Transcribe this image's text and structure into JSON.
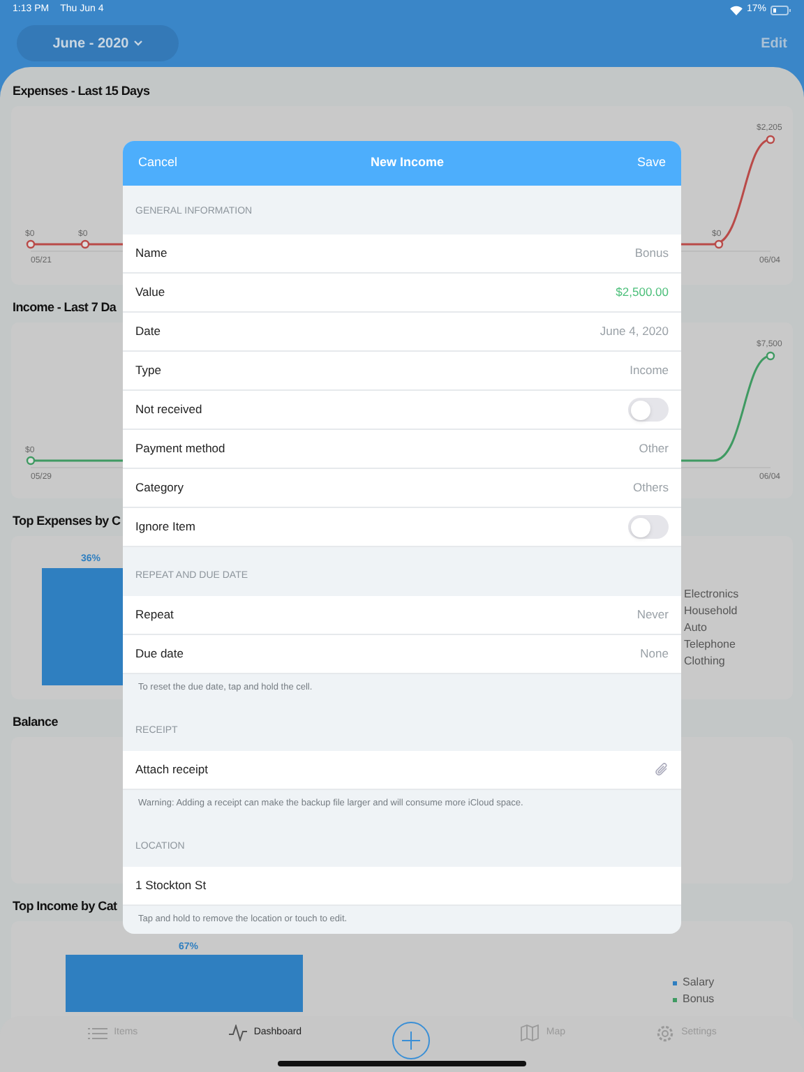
{
  "status_bar": {
    "time": "1:13 PM",
    "date": "Thu Jun 4",
    "battery": "17%"
  },
  "header": {
    "period": "June - 2020",
    "edit": "Edit"
  },
  "dashboard": [
    {
      "title": "Expenses - Last 15 Days",
      "kind": "line",
      "color": "#b94a48",
      "start_labels": [
        "$0",
        "$0"
      ],
      "end_labels": [
        "$0",
        "$2,205"
      ],
      "x_start": "05/21",
      "x_end": "06/04"
    },
    {
      "title": "Income - Last 7 Da",
      "kind": "line",
      "color": "#3f9a62",
      "start_labels": [
        "$0"
      ],
      "end_labels": [
        "$7,500"
      ],
      "x_start": "05/29",
      "x_end": "06/04"
    },
    {
      "title": "Top Expenses by C",
      "kind": "bar",
      "bar_label": "36%",
      "legend": [
        {
          "label": "Electronics"
        },
        {
          "label": "Household"
        },
        {
          "label": "Auto"
        },
        {
          "label": "Telephone"
        },
        {
          "label": "Clothing"
        }
      ]
    },
    {
      "title": "Balance",
      "kind": "empty"
    },
    {
      "title": "Top Income by Cat",
      "kind": "bar",
      "bar_label": "67%",
      "legend": [
        {
          "label": "Salary",
          "color": "#2f7fc0"
        },
        {
          "label": "Bonus",
          "color": "#3f9a62"
        }
      ]
    }
  ],
  "tab_bar": [
    {
      "label": "Items",
      "selected": false
    },
    {
      "label": "Dashboard",
      "selected": true
    },
    {
      "kind": "add"
    },
    {
      "label": "Map",
      "selected": false
    },
    {
      "label": "Settings",
      "selected": false
    }
  ],
  "modal": {
    "cancel": "Cancel",
    "title": "New Income",
    "save": "Save",
    "sections": [
      {
        "header": "GENERAL INFORMATION",
        "rows": [
          {
            "kind": "value",
            "label": "Name",
            "value": "Bonus"
          },
          {
            "kind": "money",
            "label": "Value",
            "value": "$2,500.00"
          },
          {
            "kind": "value",
            "label": "Date",
            "value": "June 4, 2020"
          },
          {
            "kind": "value",
            "label": "Type",
            "value": "Income"
          },
          {
            "kind": "toggle",
            "label": "Not received",
            "on": false
          },
          {
            "kind": "value",
            "label": "Payment method",
            "value": "Other"
          },
          {
            "kind": "value",
            "label": "Category",
            "value": "Others"
          },
          {
            "kind": "toggle",
            "label": "Ignore Item",
            "on": false
          }
        ]
      },
      {
        "header": "REPEAT AND DUE DATE",
        "rows": [
          {
            "kind": "value",
            "label": "Repeat",
            "value": "Never"
          },
          {
            "kind": "value",
            "label": "Due date",
            "value": "None"
          }
        ],
        "footer": "To reset the due date, tap and hold the cell."
      },
      {
        "header": "RECEIPT",
        "rows": [
          {
            "kind": "attachment",
            "label": "Attach receipt"
          }
        ],
        "footer": "Warning: Adding a receipt can make the backup file larger and will consume more iCloud space."
      },
      {
        "header": "LOCATION",
        "rows": [
          {
            "kind": "plain",
            "label": "1 Stockton St"
          }
        ],
        "footer": "Tap and hold to remove the location or touch to edit."
      }
    ]
  }
}
